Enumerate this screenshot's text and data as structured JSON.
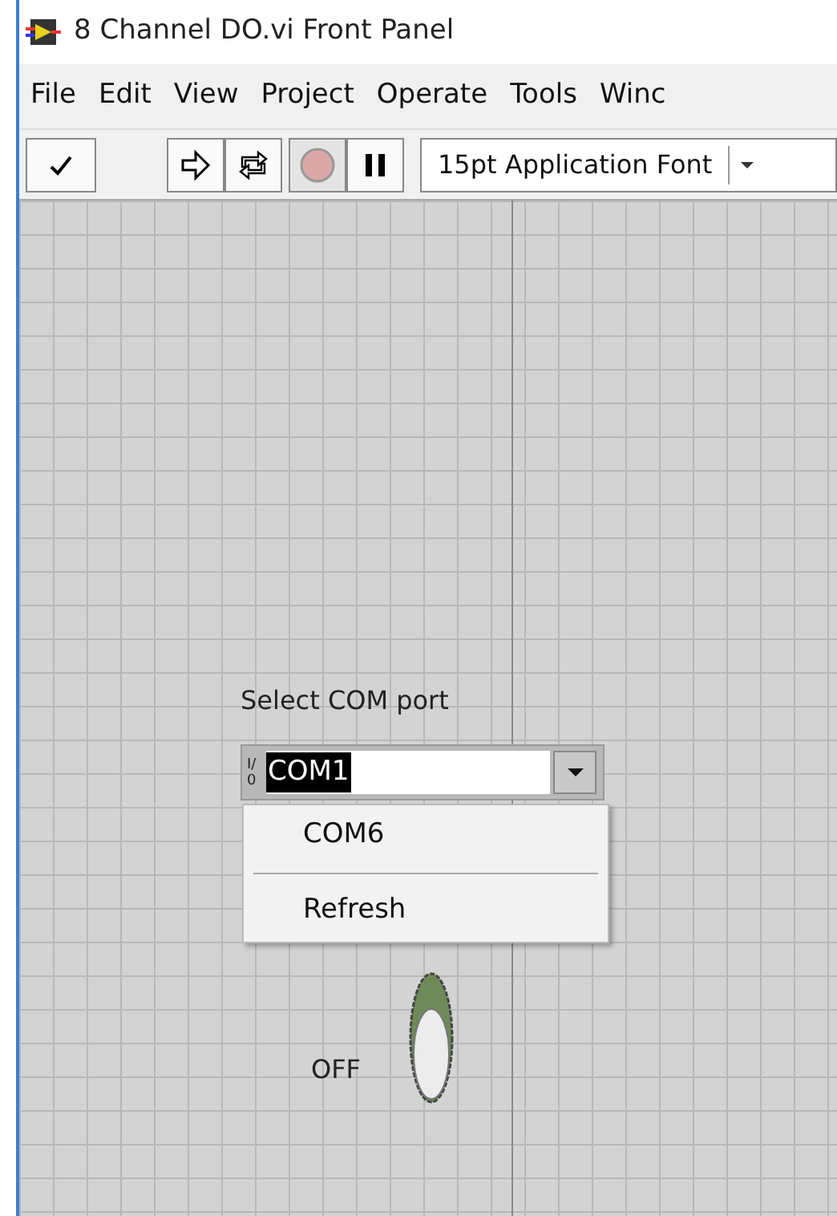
{
  "window": {
    "title": "8 Channel DO.vi Front Panel"
  },
  "menu": [
    "File",
    "Edit",
    "View",
    "Project",
    "Operate",
    "Tools",
    "Winc"
  ],
  "toolbar": {
    "buttons": [
      {
        "kind": "check",
        "disabled": false
      },
      {
        "kind": "run",
        "disabled": false
      },
      {
        "kind": "run-continuous",
        "disabled": false
      },
      {
        "kind": "abort",
        "disabled": true
      },
      {
        "kind": "pause",
        "disabled": false
      }
    ],
    "font": "15pt Application Font"
  },
  "com_port": {
    "label": "Select COM port",
    "io_glyph": "I/0",
    "value": "COM1",
    "value_selected": true,
    "expanded": true,
    "options": [
      {
        "kind": "item",
        "label": "COM6"
      },
      {
        "kind": "separator"
      },
      {
        "kind": "item",
        "label": "Refresh"
      }
    ]
  },
  "daq_switch": {
    "on": false,
    "state_text": "OFF"
  }
}
